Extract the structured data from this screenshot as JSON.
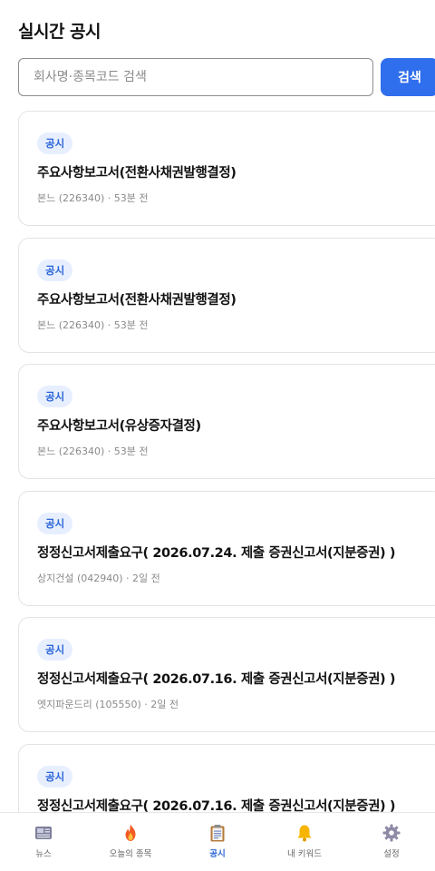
{
  "header": {
    "title": "실시간 공시"
  },
  "search": {
    "placeholder": "회사명·종목코드 검색",
    "value": "",
    "button_label": "검색"
  },
  "disclosures": [
    {
      "badge": "공시",
      "title": "주요사항보고서(전환사채권발행결정)",
      "meta": "본느 (226340) · 53분 전"
    },
    {
      "badge": "공시",
      "title": "주요사항보고서(전환사채권발행결정)",
      "meta": "본느 (226340) · 53분 전"
    },
    {
      "badge": "공시",
      "title": "주요사항보고서(유상증자결정)",
      "meta": "본느 (226340) · 53분 전"
    },
    {
      "badge": "공시",
      "title": "정정신고서제출요구( 2026.07.24. 제출 증권신고서(지분증권) )",
      "meta": "상지건설 (042940) · 2일 전"
    },
    {
      "badge": "공시",
      "title": "정정신고서제출요구( 2026.07.16. 제출 증권신고서(지분증권) )",
      "meta": "엣지파운드리 (105550) · 2일 전"
    },
    {
      "badge": "공시",
      "title": "정정신고서제출요구( 2026.07.16. 제출 증권신고서(지분증권) )",
      "meta": ""
    }
  ],
  "nav": {
    "items": [
      {
        "label": "뉴스",
        "icon": "newspaper-icon",
        "active": false
      },
      {
        "label": "오늘의 종목",
        "icon": "fire-icon",
        "active": false
      },
      {
        "label": "공시",
        "icon": "clipboard-icon",
        "active": true
      },
      {
        "label": "내 키워드",
        "icon": "bell-icon",
        "active": false
      },
      {
        "label": "설정",
        "icon": "gear-icon",
        "active": false
      }
    ]
  },
  "colors": {
    "accent": "#2f6fed",
    "badge_bg": "#e7efff",
    "badge_text": "#2a64d6"
  }
}
